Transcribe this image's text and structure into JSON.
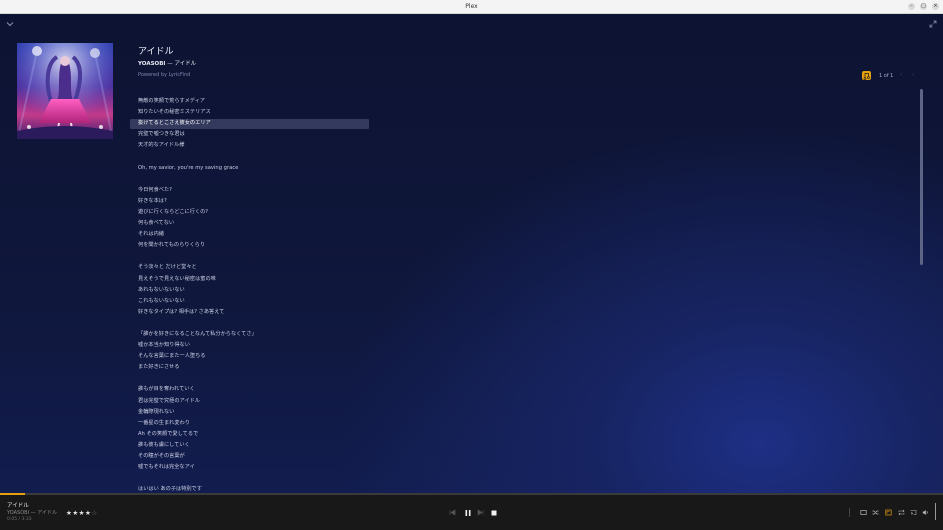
{
  "window": {
    "title": "Plex"
  },
  "icons": {
    "collapse": "chevron-down-icon",
    "expand": "expand-icon",
    "lyrics": "lyrics-icon",
    "minimize": "minimize-icon",
    "maximize": "maximize-icon",
    "close": "close-icon"
  },
  "track": {
    "title": "アイドル",
    "artist": "YOASOBI",
    "album_sep": " — アイドル",
    "powered_by": "Powered by LyricFind",
    "page_count": "1 of 1"
  },
  "lyrics": [
    "無敵の笑顔で荒らすメディア",
    "知りたいその秘密ミステリアス",
    "抜けてるとこさえ彼女のエリア",
    "完璧で嘘つきな君は",
    "天才的なアイドル様",
    "",
    "Oh, my savior, you're my saving grace",
    "",
    "今日何食べた?",
    "好きな本は?",
    "遊びに行くならどこに行くの?",
    "何も食べてない",
    "それは内緒",
    "何を聞かれてものらりくらり",
    "",
    "そう淡々と だけど堂々と",
    "見えそうで見えない秘密は蜜の味",
    "あれもないないない",
    "これもないないない",
    "好きなタイプは? 相手は? さあ答えて",
    "",
    "「誰かを好きになることなんて私分からなくてさ」",
    "嘘か本当か知り得ない",
    "そんな言葉にまた一人堕ちる",
    "また好きにさせる",
    "",
    "誰もが目を奪われていく",
    "君は完璧で究極のアイドル",
    "金輪際現れない",
    "一番星の生まれ変わり",
    "Ah その笑顔で愛してるで",
    "誰も彼も虜にしていく",
    "その瞳がその言葉が",
    "嘘でもそれは完全なアイ",
    "",
    "はいはい あの子は特別です"
  ],
  "active_line_index": 2,
  "player": {
    "title": "アイドル",
    "artist_line": "YOASOBI — アイドル",
    "time": "0:05 / 3:33",
    "progress": 0.027,
    "rating": 4,
    "rating_max": 5,
    "pause_icon": "pause-icon",
    "stop_icon": "stop-icon",
    "prev_icon": "previous-icon",
    "next_icon": "next-icon"
  },
  "colors": {
    "accent": "#e5a00d",
    "background": "#0d1433",
    "player_bg": "#181818"
  }
}
